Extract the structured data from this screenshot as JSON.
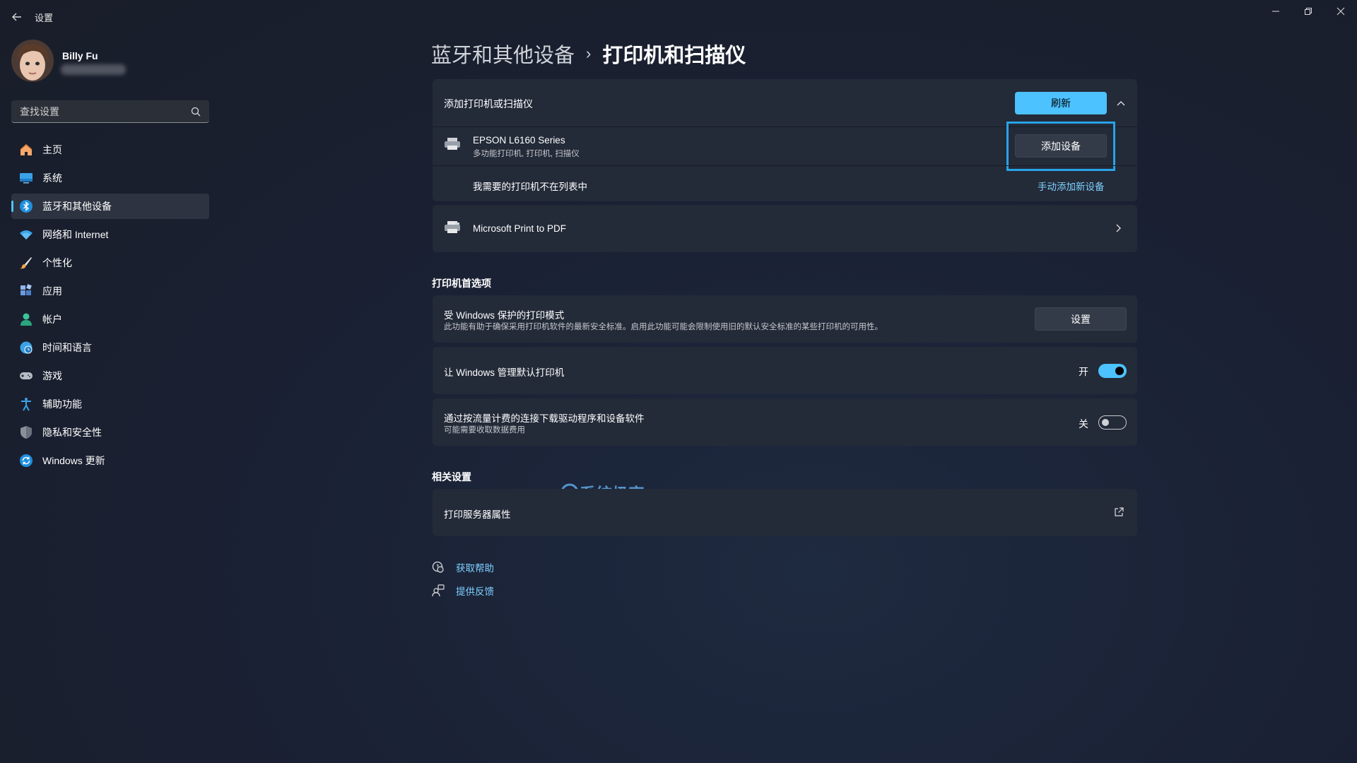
{
  "app": {
    "title": "设置"
  },
  "window_controls": {
    "minimize": "minimize-icon",
    "restore": "restore-icon",
    "close": "close-icon"
  },
  "user": {
    "name": "Billy Fu"
  },
  "search": {
    "placeholder": "查找设置"
  },
  "sidebar": {
    "items": [
      {
        "label": "主页",
        "icon": "home-icon",
        "active": false
      },
      {
        "label": "系统",
        "icon": "display-icon",
        "active": false
      },
      {
        "label": "蓝牙和其他设备",
        "icon": "bluetooth-icon",
        "active": true
      },
      {
        "label": "网络和 Internet",
        "icon": "wifi-icon",
        "active": false
      },
      {
        "label": "个性化",
        "icon": "brush-icon",
        "active": false
      },
      {
        "label": "应用",
        "icon": "apps-icon",
        "active": false
      },
      {
        "label": "帐户",
        "icon": "account-icon",
        "active": false
      },
      {
        "label": "时间和语言",
        "icon": "globe-clock-icon",
        "active": false
      },
      {
        "label": "游戏",
        "icon": "gamepad-icon",
        "active": false
      },
      {
        "label": "辅助功能",
        "icon": "accessibility-icon",
        "active": false
      },
      {
        "label": "隐私和安全性",
        "icon": "shield-icon",
        "active": false
      },
      {
        "label": "Windows 更新",
        "icon": "update-icon",
        "active": false
      }
    ]
  },
  "breadcrumb": {
    "parent": "蓝牙和其他设备",
    "separator": "›",
    "current": "打印机和扫描仪"
  },
  "add_panel": {
    "title": "添加打印机或扫描仪",
    "refresh_button": "刷新",
    "device": {
      "name": "EPSON L6160 Series",
      "description": "多功能打印机, 打印机, 扫描仪",
      "add_button": "添加设备"
    },
    "not_listed": {
      "text": "我需要的打印机不在列表中",
      "link": "手动添加新设备"
    }
  },
  "printers": [
    {
      "name": "Microsoft Print to PDF"
    }
  ],
  "preferences": {
    "title": "打印机首选项",
    "protected_mode": {
      "title": "受 Windows 保护的打印模式",
      "description": "此功能有助于确保采用打印机软件的最新安全标准。启用此功能可能会限制使用旧的默认安全标准的某些打印机的可用性。",
      "button": "设置"
    },
    "manage_default": {
      "title": "让 Windows 管理默认打印机",
      "state_label": "开",
      "on": true
    },
    "metered": {
      "title": "通过按流量计费的连接下载驱动程序和设备软件",
      "description": "可能需要收取数据费用",
      "state_label": "关",
      "on": false
    }
  },
  "related": {
    "title": "相关设置",
    "print_server": "打印服务器属性"
  },
  "help": {
    "get_help": "获取帮助",
    "feedback": "提供反馈"
  },
  "watermark": {
    "text": "系统极客"
  },
  "colors": {
    "accent": "#4cc2ff",
    "card": "#232a38",
    "highlight": "#27a4e8"
  }
}
